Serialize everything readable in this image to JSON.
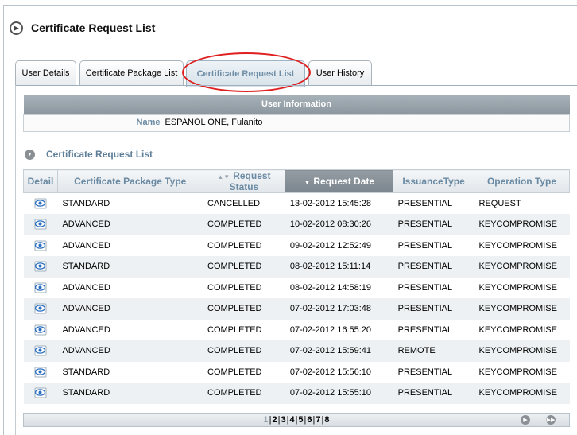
{
  "page": {
    "title": "Certificate Request List"
  },
  "tabs": [
    {
      "label": "User Details"
    },
    {
      "label": "Certificate Package List"
    },
    {
      "label": "Certificate Request List"
    },
    {
      "label": "User History"
    }
  ],
  "user_info": {
    "header": "User Information",
    "name_label": "Name",
    "name_value": "ESPANOL ONE, Fulanito"
  },
  "section": {
    "title": "Certificate Request List"
  },
  "table": {
    "columns": [
      {
        "label": "Detail"
      },
      {
        "label": "Certificate Package Type"
      },
      {
        "label": "Request Status"
      },
      {
        "label": "Request Date"
      },
      {
        "label": "IssuanceType"
      },
      {
        "label": "Operation Type"
      }
    ],
    "rows": [
      {
        "package": "STANDARD",
        "status": "CANCELLED",
        "date": "13-02-2012 15:45:28",
        "issuance": "PRESENTIAL",
        "operation": "REQUEST"
      },
      {
        "package": "ADVANCED",
        "status": "COMPLETED",
        "date": "10-02-2012 08:30:26",
        "issuance": "PRESENTIAL",
        "operation": "KEYCOMPROMISE"
      },
      {
        "package": "ADVANCED",
        "status": "COMPLETED",
        "date": "09-02-2012 12:52:49",
        "issuance": "PRESENTIAL",
        "operation": "KEYCOMPROMISE"
      },
      {
        "package": "STANDARD",
        "status": "COMPLETED",
        "date": "08-02-2012 15:11:14",
        "issuance": "PRESENTIAL",
        "operation": "KEYCOMPROMISE"
      },
      {
        "package": "ADVANCED",
        "status": "COMPLETED",
        "date": "08-02-2012 14:58:19",
        "issuance": "PRESENTIAL",
        "operation": "KEYCOMPROMISE"
      },
      {
        "package": "ADVANCED",
        "status": "COMPLETED",
        "date": "07-02-2012 17:03:48",
        "issuance": "PRESENTIAL",
        "operation": "KEYCOMPROMISE"
      },
      {
        "package": "ADVANCED",
        "status": "COMPLETED",
        "date": "07-02-2012 16:55:20",
        "issuance": "PRESENTIAL",
        "operation": "KEYCOMPROMISE"
      },
      {
        "package": "ADVANCED",
        "status": "COMPLETED",
        "date": "07-02-2012 15:59:41",
        "issuance": "REMOTE",
        "operation": "KEYCOMPROMISE"
      },
      {
        "package": "STANDARD",
        "status": "COMPLETED",
        "date": "07-02-2012 15:56:10",
        "issuance": "PRESENTIAL",
        "operation": "KEYCOMPROMISE"
      },
      {
        "package": "STANDARD",
        "status": "COMPLETED",
        "date": "07-02-2012 15:55:10",
        "issuance": "PRESENTIAL",
        "operation": "KEYCOMPROMISE"
      }
    ]
  },
  "pager": {
    "pages": [
      "1",
      "2",
      "3",
      "4",
      "5",
      "6",
      "7",
      "8"
    ],
    "current": "1"
  },
  "colors": {
    "accent": "#6a8aa3",
    "highlight": "#e02020",
    "header_gray": "#8c979f"
  },
  "icons": {
    "title": "circle-arrow-right-icon",
    "section": "circle-arrow-down-icon",
    "detail": "eye-icon",
    "next": "circle-arrow-right-icon",
    "last": "double-arrow-right-icon"
  }
}
